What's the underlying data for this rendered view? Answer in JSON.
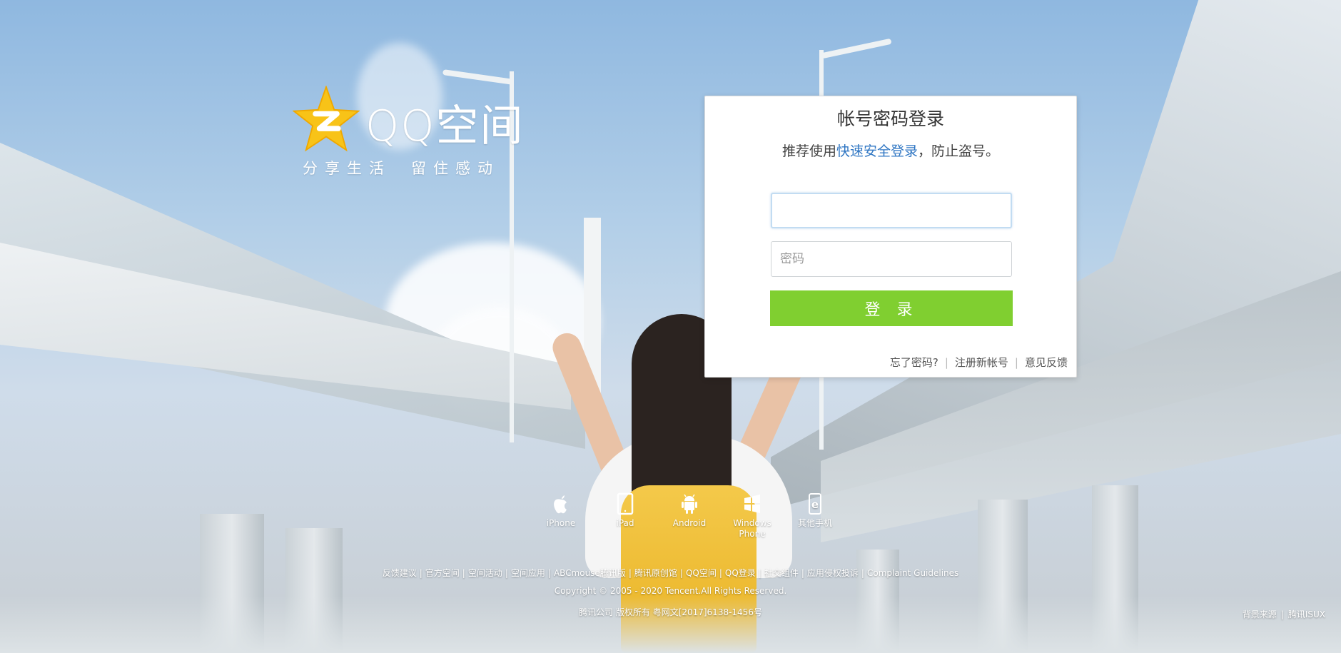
{
  "logo": {
    "text": "QQ空间",
    "slogan_left": "分享生活",
    "slogan_right": "留住感动",
    "icon": "qzone-star-icon"
  },
  "login": {
    "title": "帐号密码登录",
    "tip_prefix": "推荐使用",
    "tip_link": "快速安全登录",
    "tip_suffix": "，防止盗号。",
    "username_value": "",
    "password_placeholder": "密码",
    "submit_label": "登 录",
    "links": {
      "forgot": "忘了密码?",
      "register": "注册新帐号",
      "feedback": "意见反馈"
    },
    "colors": {
      "button": "#80cf30",
      "link": "#2f76c3"
    }
  },
  "devices": [
    {
      "label": "iPhone",
      "icon": "apple-icon"
    },
    {
      "label": "iPad",
      "icon": "tablet-icon"
    },
    {
      "label": "Android",
      "icon": "android-icon"
    },
    {
      "label": "Windows Phone",
      "icon": "windows-icon"
    },
    {
      "label": "其他手机",
      "icon": "ie-phone-icon"
    }
  ],
  "footer": {
    "links": [
      "反馈建议",
      "官方空间",
      "空间活动",
      "空间应用",
      "ABCmouse腾讯版",
      "腾讯原创馆",
      "QQ空间",
      "QQ登录",
      "社交组件",
      "应用侵权投诉",
      "Complaint Guidelines"
    ],
    "copyright": "Copyright © 2005 - 2020 Tencent.All Rights Reserved.",
    "icp": "腾讯公司 版权所有 粤网文[2017]6138-1456号",
    "bg_source_label": "背景来源",
    "bg_source_value": "腾讯ISUX"
  }
}
